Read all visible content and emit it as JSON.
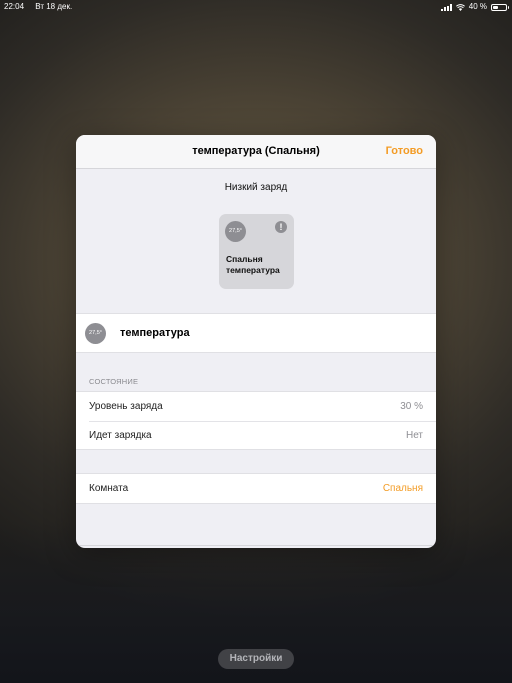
{
  "status_bar": {
    "time": "22:04",
    "date": "Вт 18 дек.",
    "battery_text": "40 %",
    "battery_level": 0.4
  },
  "modal": {
    "title": "температура (Спальня)",
    "done_label": "Готово",
    "low_battery_label": "Низкий заряд",
    "tile": {
      "reading": "27,5°",
      "warning_glyph": "!",
      "name_line1": "Спальня",
      "name_line2": "температура"
    },
    "accessory": {
      "reading": "27,5°",
      "name": "температура"
    },
    "state_section": {
      "header": "СОСТОЯНИЕ",
      "rows": [
        {
          "label": "Уровень заряда",
          "value": "30 %"
        },
        {
          "label": "Идет зарядка",
          "value": "Нет"
        }
      ]
    },
    "room_row": {
      "label": "Комната",
      "value": "Спальня"
    }
  },
  "bottom": {
    "settings_label": "Настройки"
  },
  "colors": {
    "accent": "#f39c26",
    "icon_gray": "#8e8e93",
    "background_grouped": "#efeff4"
  }
}
